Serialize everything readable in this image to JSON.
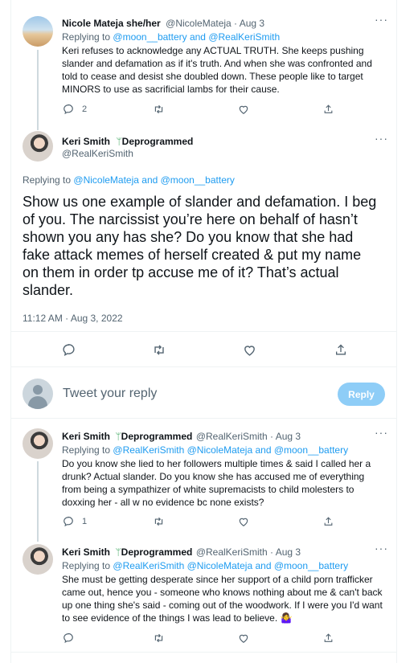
{
  "tweet1": {
    "name": "Nicole Mateja she/her",
    "handle_date": "@NicoleMateja · Aug 3",
    "replying_prefix": "Replying to",
    "replying_to": "@moon__battery and @RealKeriSmith",
    "lines": [
      "Keri refuses to acknowledge any ACTUAL TRUTH. She keeps pushing",
      "slander and defamation as if it's truth. And when she was confronted and",
      "told to cease and desist she doubled down. These people like to target",
      "MINORS to use as sacrificial lambs for their cause."
    ],
    "reply_count": "2"
  },
  "main": {
    "name": "Keri Smith",
    "badge_text": "Deprogrammed",
    "handle": "@RealKeriSmith",
    "replying_prefix": "Replying to",
    "replying_to": "@NicoleMateja and @moon__battery",
    "lines": [
      "Show us one example of slander and defamation. I beg",
      "of you. The narcissist you’re here on behalf of hasn’t",
      "shown you any has she? Do you know that she had",
      "fake attack memes of herself created & put my name",
      "on them in order tp accuse me of it? That’s actual",
      "slander."
    ],
    "timestamp": "11:12 AM · Aug 3, 2022"
  },
  "compose": {
    "placeholder": "Tweet your reply",
    "button": "Reply"
  },
  "reply1": {
    "name": "Keri Smith",
    "badge_text": "Deprogrammed",
    "handle_date": "@RealKeriSmith · Aug 3",
    "replying_prefix": "Replying to",
    "replying_to": "@RealKeriSmith @NicoleMateja and @moon__battery",
    "lines": [
      "Do you know she lied to her followers multiple times & said I called her a",
      "drunk? Actual slander. Do you know she has accused me of everything",
      "from being a sympathizer of white supremacists to child molesters to",
      "doxxing her - all w no evidence bc none exists?"
    ],
    "reply_count": "1"
  },
  "reply2": {
    "name": "Keri Smith",
    "badge_text": "Deprogrammed",
    "handle_date": "@RealKeriSmith · Aug 3",
    "replying_prefix": "Replying to",
    "replying_to": "@RealKeriSmith @NicoleMateja and @moon__battery",
    "lines": [
      "She must be getting desperate since her support of a child porn trafficker",
      "came out, hence you - someone who knows nothing about me & can't back",
      "up one thing she's said - coming out of the woodwork. If I were you I'd want",
      "to see evidence of the things I was lead to believe. 🤷‍♀️"
    ]
  },
  "icons": {
    "more": "more-icon",
    "reply": "reply-icon",
    "retweet": "retweet-icon",
    "like": "like-icon",
    "share": "share-icon",
    "badge": "sprout-icon"
  },
  "colors": {
    "link": "#1d9bf0",
    "muted": "#536471",
    "reply_button": "#8ecdf7",
    "badge": "#3aa55d"
  }
}
